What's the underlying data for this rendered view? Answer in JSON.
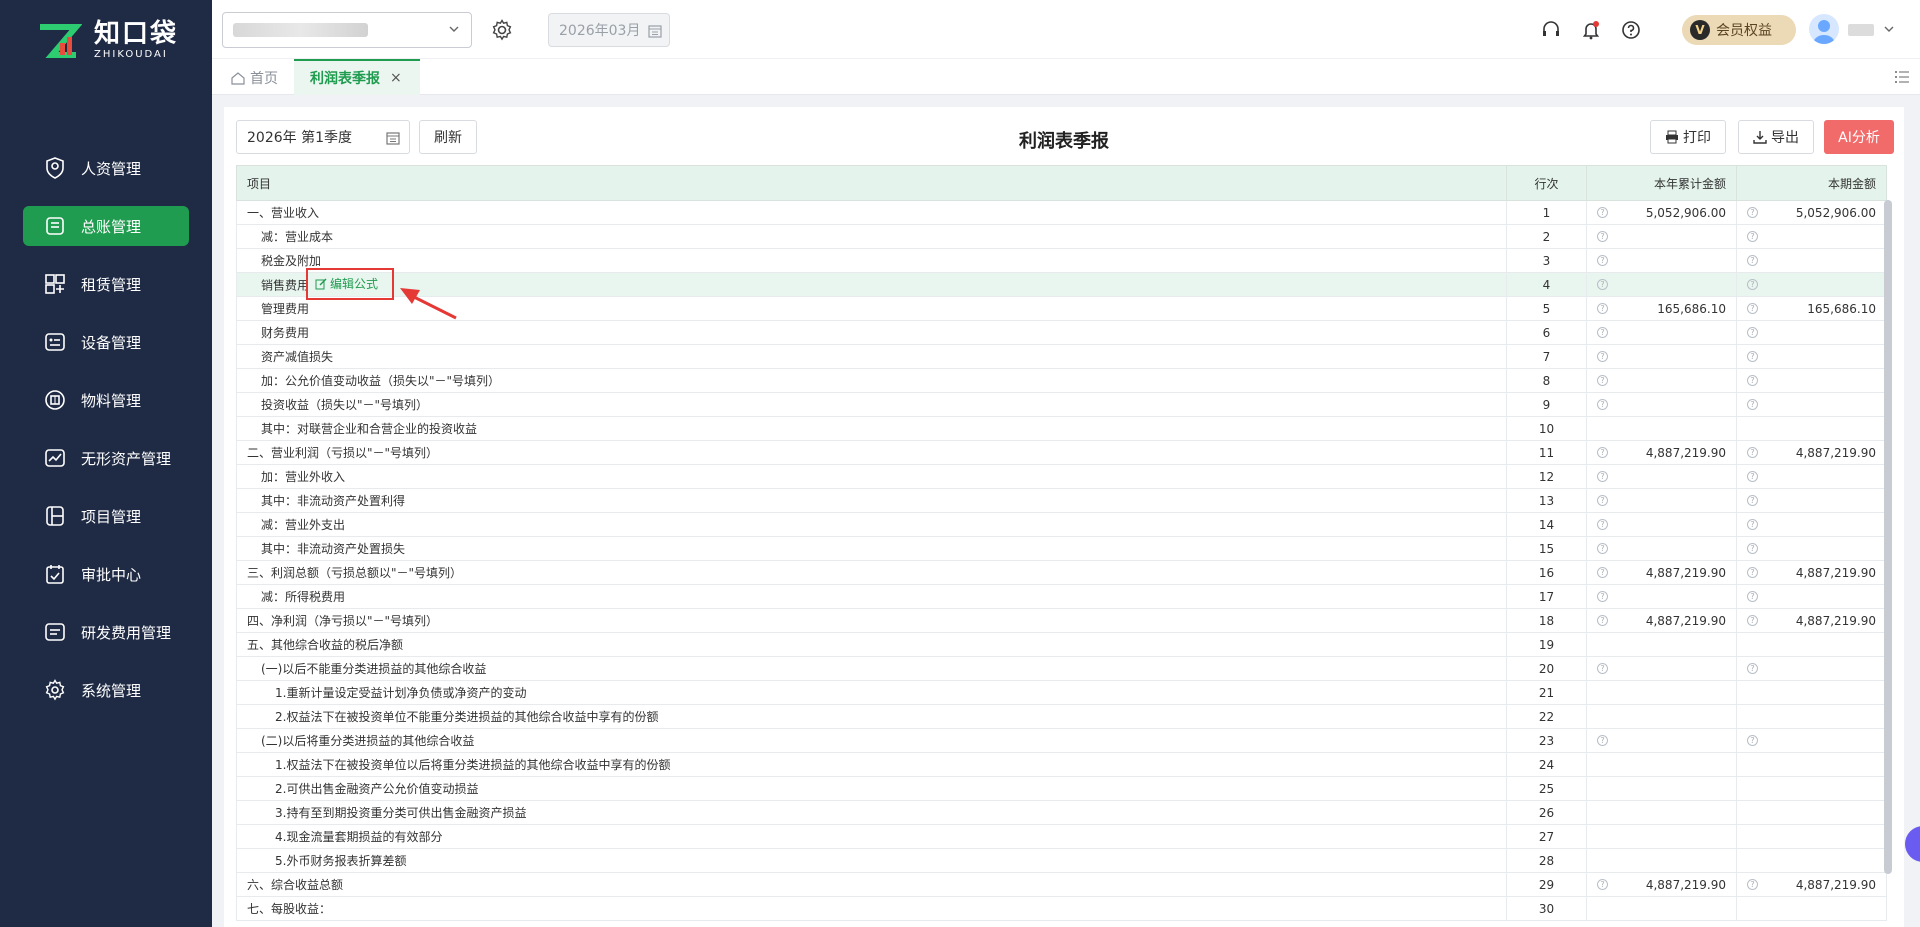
{
  "brand": {
    "name_cn": "知口袋",
    "name_en": "ZHIKOUDAI"
  },
  "sidebar": {
    "items": [
      {
        "label": "人资管理",
        "icon": "person-shield-icon",
        "active": false
      },
      {
        "label": "总账管理",
        "icon": "ledger-icon",
        "active": true
      },
      {
        "label": "租赁管理",
        "icon": "lease-icon",
        "active": false
      },
      {
        "label": "设备管理",
        "icon": "device-icon",
        "active": false
      },
      {
        "label": "物料管理",
        "icon": "material-icon",
        "active": false
      },
      {
        "label": "无形资产管理",
        "icon": "intangible-asset-icon",
        "active": false
      },
      {
        "label": "项目管理",
        "icon": "project-icon",
        "active": false
      },
      {
        "label": "审批中心",
        "icon": "approval-icon",
        "active": false
      },
      {
        "label": "研发费用管理",
        "icon": "rnd-icon",
        "active": false
      },
      {
        "label": "系统管理",
        "icon": "gear-icon",
        "active": false
      }
    ]
  },
  "topbar": {
    "period": "2026年03月",
    "vip_label": "会员权益",
    "vip_badge": "V"
  },
  "tabs": {
    "home": "首页",
    "active": "利润表季报",
    "close": "×"
  },
  "toolbar": {
    "quarter": "2026年 第1季度",
    "refresh": "刷新",
    "title": "利润表季报",
    "print": "打印",
    "export": "导出",
    "ai": "AI分析"
  },
  "table": {
    "headers": {
      "item": "项目",
      "line": "行次",
      "ytd": "本年累计金额",
      "period": "本期金额"
    },
    "edit_formula": "编辑公式",
    "rows": [
      {
        "item": "一、营业收入",
        "line": "1",
        "ytd": "5,052,906.00",
        "period": "5,052,906.00",
        "q": true,
        "indent": 0
      },
      {
        "item": "减：营业成本",
        "line": "2",
        "ytd": "",
        "period": "",
        "q": true,
        "indent": 1
      },
      {
        "item": "税金及附加",
        "line": "3",
        "ytd": "",
        "period": "",
        "q": true,
        "indent": 1
      },
      {
        "item": "销售费用",
        "line": "4",
        "ytd": "",
        "period": "",
        "q": true,
        "indent": 1,
        "highlight": true
      },
      {
        "item": "管理费用",
        "line": "5",
        "ytd": "165,686.10",
        "period": "165,686.10",
        "q": true,
        "indent": 1
      },
      {
        "item": "财务费用",
        "line": "6",
        "ytd": "",
        "period": "",
        "q": true,
        "indent": 1
      },
      {
        "item": "资产减值损失",
        "line": "7",
        "ytd": "",
        "period": "",
        "q": true,
        "indent": 1
      },
      {
        "item": "加：公允价值变动收益（损失以\"－\"号填列）",
        "line": "8",
        "ytd": "",
        "period": "",
        "q": true,
        "indent": 1
      },
      {
        "item": "投资收益（损失以\"－\"号填列）",
        "line": "9",
        "ytd": "",
        "period": "",
        "q": true,
        "indent": 1
      },
      {
        "item": "其中：对联营企业和合营企业的投资收益",
        "line": "10",
        "ytd": "",
        "period": "",
        "q": false,
        "indent": 1
      },
      {
        "item": "二、营业利润（亏损以\"－\"号填列）",
        "line": "11",
        "ytd": "4,887,219.90",
        "period": "4,887,219.90",
        "q": true,
        "indent": 0
      },
      {
        "item": "加：营业外收入",
        "line": "12",
        "ytd": "",
        "period": "",
        "q": true,
        "indent": 1
      },
      {
        "item": "其中：非流动资产处置利得",
        "line": "13",
        "ytd": "",
        "period": "",
        "q": true,
        "indent": 1
      },
      {
        "item": "减：营业外支出",
        "line": "14",
        "ytd": "",
        "period": "",
        "q": true,
        "indent": 1
      },
      {
        "item": "其中：非流动资产处置损失",
        "line": "15",
        "ytd": "",
        "period": "",
        "q": true,
        "indent": 1
      },
      {
        "item": "三、利润总额（亏损总额以\"－\"号填列）",
        "line": "16",
        "ytd": "4,887,219.90",
        "period": "4,887,219.90",
        "q": true,
        "indent": 0
      },
      {
        "item": "减：所得税费用",
        "line": "17",
        "ytd": "",
        "period": "",
        "q": true,
        "indent": 1
      },
      {
        "item": "四、净利润（净亏损以\"－\"号填列）",
        "line": "18",
        "ytd": "4,887,219.90",
        "period": "4,887,219.90",
        "q": true,
        "indent": 0
      },
      {
        "item": "五、其他综合收益的税后净额",
        "line": "19",
        "ytd": "",
        "period": "",
        "q": false,
        "indent": 0
      },
      {
        "item": "(一)以后不能重分类进损益的其他综合收益",
        "line": "20",
        "ytd": "",
        "period": "",
        "q": true,
        "indent": 1
      },
      {
        "item": "1.重新计量设定受益计划净负债或净资产的变动",
        "line": "21",
        "ytd": "",
        "period": "",
        "q": false,
        "indent": 2
      },
      {
        "item": "2.权益法下在被投资单位不能重分类进损益的其他综合收益中享有的份额",
        "line": "22",
        "ytd": "",
        "period": "",
        "q": false,
        "indent": 2
      },
      {
        "item": "(二)以后将重分类进损益的其他综合收益",
        "line": "23",
        "ytd": "",
        "period": "",
        "q": true,
        "indent": 1
      },
      {
        "item": "1.权益法下在被投资单位以后将重分类进损益的其他综合收益中享有的份额",
        "line": "24",
        "ytd": "",
        "period": "",
        "q": false,
        "indent": 2
      },
      {
        "item": "2.可供出售金融资产公允价值变动损益",
        "line": "25",
        "ytd": "",
        "period": "",
        "q": false,
        "indent": 2
      },
      {
        "item": "3.持有至到期投资重分类可供出售金融资产损益",
        "line": "26",
        "ytd": "",
        "period": "",
        "q": false,
        "indent": 2
      },
      {
        "item": "4.现金流量套期损益的有效部分",
        "line": "27",
        "ytd": "",
        "period": "",
        "q": false,
        "indent": 2
      },
      {
        "item": "5.外币财务报表折算差额",
        "line": "28",
        "ytd": "",
        "period": "",
        "q": false,
        "indent": 2
      },
      {
        "item": "六、综合收益总额",
        "line": "29",
        "ytd": "4,887,219.90",
        "period": "4,887,219.90",
        "q": true,
        "indent": 0
      },
      {
        "item": "七、每股收益：",
        "line": "30",
        "ytd": "",
        "period": "",
        "q": false,
        "indent": 0
      }
    ]
  },
  "colors": {
    "brand_green": "#1f9c4f",
    "sidebar_bg": "#1f2a44",
    "ai_red": "#f26b6b",
    "header_green": "#e4f4ec"
  }
}
